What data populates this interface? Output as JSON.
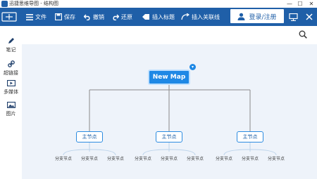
{
  "window": {
    "title": "迅捷思维导图 - 结构图",
    "minimize": "—",
    "maximize": "☐",
    "close": "✕"
  },
  "toolbar": {
    "file": "文件",
    "save": "保存",
    "undo": "撤销",
    "redo": "还原",
    "insert_title": "插入标题",
    "insert_link": "插入关联线",
    "login": "登录/注册"
  },
  "sidebar": {
    "items": [
      {
        "label": "笔记",
        "icon": "pen-icon"
      },
      {
        "label": "超链接",
        "icon": "link-icon"
      },
      {
        "label": "多媒体",
        "icon": "media-icon"
      },
      {
        "label": "图片",
        "icon": "image-icon"
      }
    ]
  },
  "mindmap": {
    "root": "New Map",
    "root_toggle": "▾",
    "main_nodes": [
      "主节点",
      "主节点",
      "主节点"
    ],
    "branch": "分支节点"
  },
  "colors": {
    "toolbar": "#1f5fa8",
    "accent": "#1e88e5",
    "canvas": "#eef3fa"
  }
}
